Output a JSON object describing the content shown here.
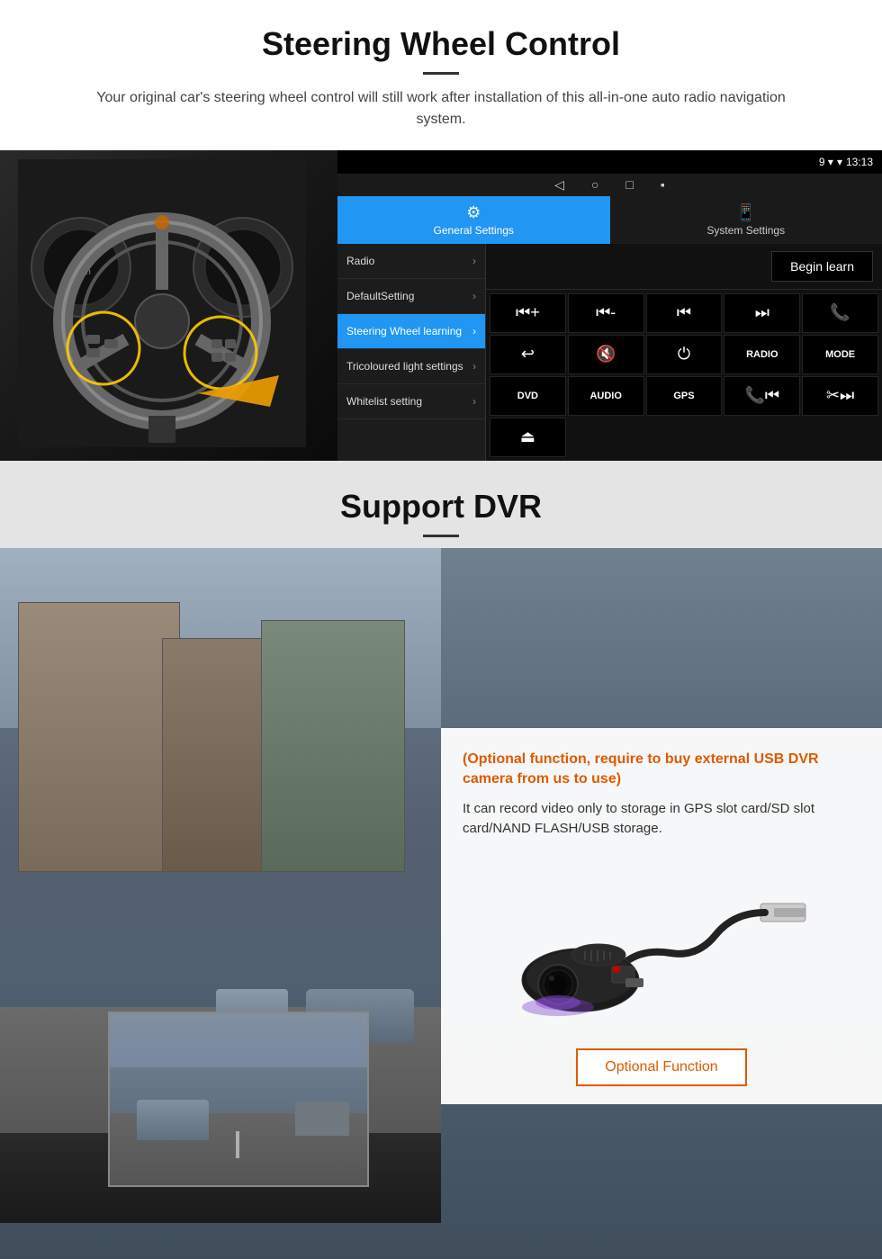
{
  "section1": {
    "title": "Steering Wheel Control",
    "subtitle": "Your original car's steering wheel control will still work after installation of this all-in-one auto radio navigation system.",
    "statusbar": {
      "time": "13:13",
      "signal": "▼ 9"
    },
    "tabs": [
      {
        "label": "General Settings",
        "icon": "⚙",
        "active": true
      },
      {
        "label": "System Settings",
        "icon": "📱",
        "active": false
      }
    ],
    "menu_items": [
      {
        "label": "Radio",
        "active": false
      },
      {
        "label": "DefaultSetting",
        "active": false
      },
      {
        "label": "Steering Wheel learning",
        "active": true
      },
      {
        "label": "Tricoloured light settings",
        "active": false
      },
      {
        "label": "Whitelist setting",
        "active": false
      }
    ],
    "begin_learn_label": "Begin learn",
    "ctrl_buttons": [
      {
        "label": "⏮+",
        "type": "icon"
      },
      {
        "label": "⏮-",
        "type": "icon"
      },
      {
        "label": "⏮",
        "type": "icon"
      },
      {
        "label": "⏭",
        "type": "icon"
      },
      {
        "label": "📞",
        "type": "icon"
      },
      {
        "label": "↩",
        "type": "icon"
      },
      {
        "label": "🔇×",
        "type": "icon"
      },
      {
        "label": "⏻",
        "type": "icon"
      },
      {
        "label": "RADIO",
        "type": "text"
      },
      {
        "label": "MODE",
        "type": "text"
      },
      {
        "label": "DVD",
        "type": "text"
      },
      {
        "label": "AUDIO",
        "type": "text"
      },
      {
        "label": "GPS",
        "type": "text"
      },
      {
        "label": "📞⏮",
        "type": "icon"
      },
      {
        "label": "✂⏭",
        "type": "icon"
      },
      {
        "label": "⏏",
        "type": "icon"
      }
    ]
  },
  "section2": {
    "title": "Support DVR",
    "optional_text": "(Optional function, require to buy external USB DVR camera from us to use)",
    "desc_text": "It can record video only to storage in GPS slot card/SD slot card/NAND FLASH/USB storage.",
    "optional_function_label": "Optional Function"
  }
}
